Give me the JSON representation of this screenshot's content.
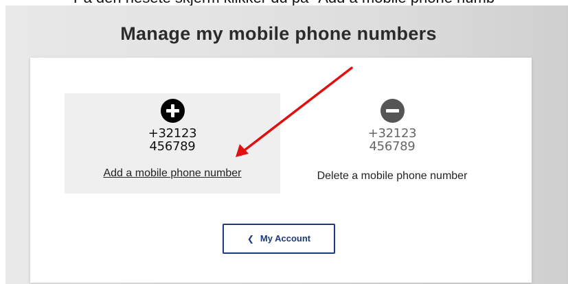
{
  "caption": {
    "text": "Pa den nesete skjerm klikker du pa \"Add a mobile phone numb"
  },
  "page": {
    "title": "Manage my mobile phone numbers"
  },
  "options": {
    "add": {
      "icon": "plus-circle-icon",
      "phone_line1": "+32123",
      "phone_line2": "456789",
      "label": "Add a mobile phone number"
    },
    "delete": {
      "icon": "minus-circle-icon",
      "phone_line1": "+32123",
      "phone_line2": "456789",
      "label": "Delete a mobile phone number"
    }
  },
  "account_button": {
    "icon": "chevron-left-icon",
    "chevron": "❮",
    "label": "My Account"
  },
  "annotation": {
    "icon": "red-arrow-icon",
    "color": "#e01010"
  },
  "colors": {
    "accent": "#1d3a78",
    "backdrop": "#e3e3e3"
  }
}
